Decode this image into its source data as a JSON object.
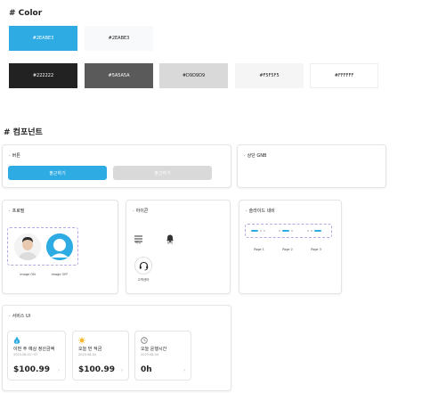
{
  "color_section": {
    "title": "# Color",
    "primary_swatches": [
      {
        "label": "#2EABE3",
        "bg": "#2EABE3",
        "fg": "#ffffff"
      },
      {
        "label": "#2EABE3",
        "bg": "#F7F9FB",
        "fg": "#222222"
      }
    ],
    "gray_swatches": [
      {
        "label": "#222222",
        "bg": "#222222",
        "fg": "#ffffff"
      },
      {
        "label": "#5A5A5A",
        "bg": "#5A5A5A",
        "fg": "#ffffff"
      },
      {
        "label": "#D9D9D9",
        "bg": "#D9D9D9",
        "fg": "#222222"
      },
      {
        "label": "#F5F5F5",
        "bg": "#F5F5F5",
        "fg": "#222222"
      },
      {
        "label": "#FFFFFF",
        "bg": "#FFFFFF",
        "fg": "#222222"
      }
    ]
  },
  "component_section": {
    "title": "# 컴포넌트",
    "button_card": {
      "title": "버튼",
      "primary_label": "출근하기",
      "disabled_label": "출근하기",
      "primary_color": "#2EABE3",
      "disabled_color": "#D9D9D9"
    },
    "gnb_card": {
      "title": "상단 GNB"
    },
    "profile_card": {
      "title": "프로필",
      "image_on_label": "image ON",
      "image_off_label": "image OFF"
    },
    "icon_card": {
      "title": "아이콘",
      "icons": [
        {
          "name": "menu-icon",
          "label": "메뉴"
        },
        {
          "name": "bell-icon",
          "label": "알림"
        },
        {
          "name": "headset-icon",
          "label": "고객센터"
        }
      ]
    },
    "slide_nav_card": {
      "title": "슬라이드 네비",
      "pages": [
        "Page 1",
        "Page 2",
        "Page 3"
      ]
    },
    "service_card": {
      "title": "서비스 UI",
      "items": [
        {
          "title": "이번 주 예상 정산금액",
          "date": "2023.08.01~07",
          "value": "$100.99",
          "icon": "money-bag-icon"
        },
        {
          "title": "오늘 번 적금",
          "date": "2023.08.04",
          "value": "$100.99",
          "icon": "sun-coin-icon"
        },
        {
          "title": "오늘 운행시간",
          "date": "2023.08.04",
          "value": "0h",
          "icon": "clock-icon"
        }
      ]
    }
  }
}
